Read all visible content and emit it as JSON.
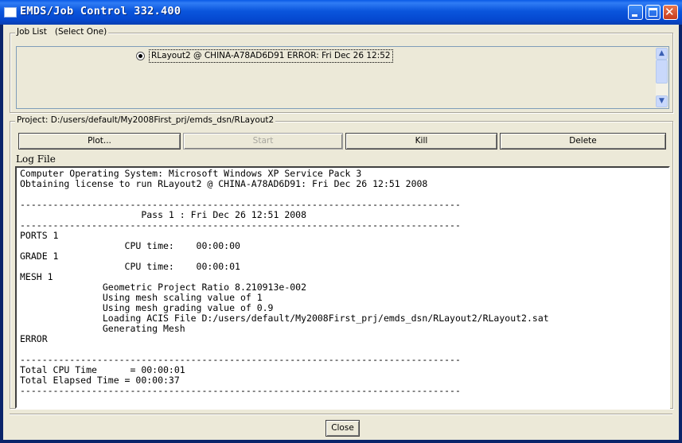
{
  "window": {
    "title": "EMDS/Job Control 332.400",
    "controls": {
      "minimize": "minimize-icon",
      "maximize": "maximize-icon",
      "close": "close-icon",
      "close_glyph": "✕"
    }
  },
  "job_list": {
    "legend": "Job List",
    "legend_hint": "(Select One)",
    "items": [
      {
        "label": "RLayout2 @ CHINA-A78AD6D91 ERROR: Fri Dec 26 12:52",
        "selected": true
      }
    ],
    "scroll": {
      "up": "▲",
      "down": "▼"
    }
  },
  "project": {
    "legend": "Project: D:/users/default/My2008First_prj/emds_dsn/RLayout2"
  },
  "buttons": {
    "plot": "Plot...",
    "start": "Start",
    "kill": "Kill",
    "delete": "Delete",
    "close": "Close"
  },
  "log": {
    "label": "Log File",
    "text": "Computer Operating System: Microsoft Windows XP Service Pack 3\nObtaining license to run RLayout2 @ CHINA-A78AD6D91: Fri Dec 26 12:51 2008\n\n--------------------------------------------------------------------------------\n                      Pass 1 : Fri Dec 26 12:51 2008\n--------------------------------------------------------------------------------\nPORTS 1\n                   CPU time:    00:00:00\nGRADE 1\n                   CPU time:    00:00:01\nMESH 1\n               Geometric Project Ratio 8.210913e-002\n               Using mesh scaling value of 1\n               Using mesh grading value of 0.9\n               Loading ACIS File D:/users/default/My2008First_prj/emds_dsn/RLayout2/RLayout2.sat\n               Generating Mesh\nERROR\n\n--------------------------------------------------------------------------------\nTotal CPU Time      = 00:00:01\nTotal Elapsed Time = 00:00:37\n--------------------------------------------------------------------------------"
  },
  "colors": {
    "titlebar": "#0a55dc",
    "window_bg": "#ece9d8",
    "disabled_text": "#a7a69e"
  }
}
